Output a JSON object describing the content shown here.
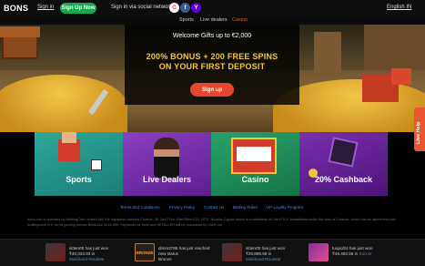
{
  "header": {
    "logo": "BONS",
    "signin": "Sign in",
    "signup": "Sign Up Now",
    "social_label": "Sign in via social networks",
    "social": [
      "G",
      "f",
      "Y"
    ],
    "language": "English IN"
  },
  "nav": {
    "tabs": [
      "Sports",
      "Live dealers",
      "Casino"
    ]
  },
  "hero": {
    "welcome": "Welcome Gifts up to €2,000",
    "bonus_line1": "200% BONUS + 200 FREE SPINS",
    "bonus_line2": "ON YOUR FIRST DEPOSIT",
    "cta": "Sign up"
  },
  "live_help": "Live Help",
  "tiles": [
    {
      "label": "Sports"
    },
    {
      "label": "Live Dealers"
    },
    {
      "label": "Casino"
    },
    {
      "label": "20% Cashback"
    }
  ],
  "footer_links": [
    "Terms and Conditions",
    "Privacy Policy",
    "Contact Us",
    "Betting Rules",
    "VIP Loyalty Program"
  ],
  "legal": "bons.com is operated by NestingCom Limited with the registered address Chytron, 30, 2nd Floor, Flat/Office A22, 1075, Nicosia, Cyprus which is a subsidiary of Clar.H N.V. established under the laws of Curacao, which has an agreement with Antillephone N.V. for its gaming license 8048/JAZ 2019-050. Payments for Skrill and NETELLER will be processed by CWS Ltd.",
  "ticker": [
    {
      "line1": "sittenrt5 has just won",
      "line2": "₹40,334.93 in",
      "game": "Multihand Roulette"
    },
    {
      "line1": "dimm2786 has just reached",
      "line2": "new status",
      "game": "Bronze"
    },
    {
      "line1": "sittenrt5 has just won",
      "line2": "₹26,889.96 in",
      "game": "Multihand Roulette"
    },
    {
      "line1": "tuupol24 has just won",
      "line2": "₹46,482.55 in",
      "game": "Soccer"
    }
  ],
  "ticker_badge": "BRONZE",
  "colors": {
    "accent": "#e8472f",
    "signup_green": "#18a84f",
    "bonus_gold": "#f5c842",
    "link_blue": "#4a8fd8"
  }
}
